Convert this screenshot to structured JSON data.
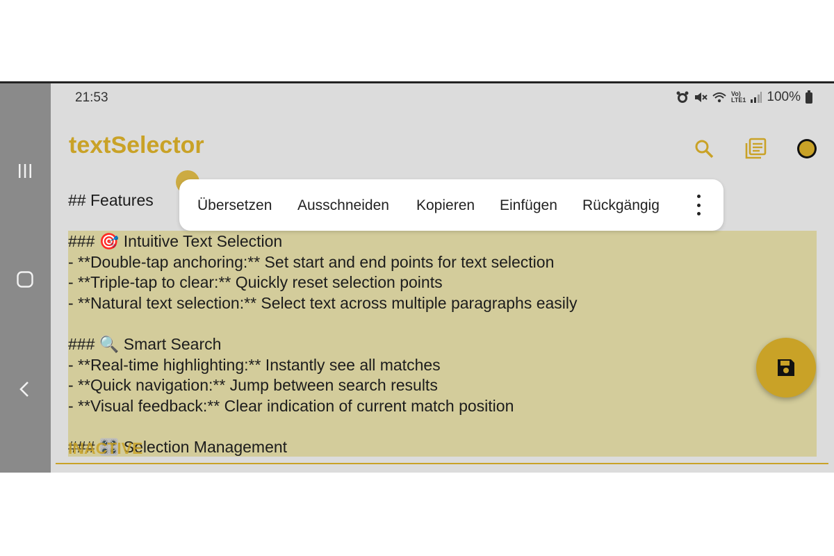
{
  "status_bar": {
    "time": "21:53",
    "signal_text": "Vo)\nLTE1",
    "battery": "100%"
  },
  "app": {
    "title": "textSelector"
  },
  "icons": {
    "search": "search-icon",
    "library": "library-icon",
    "theme": "theme-toggle-icon",
    "save": "save-icon"
  },
  "context_menu": {
    "items": [
      "Übersetzen",
      "Ausschneiden",
      "Kopieren",
      "Einfügen",
      "Rückgängig"
    ]
  },
  "editor": {
    "lines": [
      "## Features",
      "### 🎯 Intuitive Text Selection",
      "- **Double-tap anchoring:** Set start and end points for text selection",
      "- **Triple-tap to clear:** Quickly reset selection points",
      "- **Natural text selection:** Select text across multiple paragraphs easily",
      "### 🔍 Smart Search",
      "- **Real-time highlighting:** Instantly see all matches",
      "- **Quick navigation:** Jump between search results",
      "- **Visual feedback:** Clear indication of current match position",
      "### 🎛️ Selection Management"
    ],
    "overlay_label": "INACTIVE"
  },
  "colors": {
    "accent": "#c9a227",
    "selection": "#d3cc9b"
  }
}
